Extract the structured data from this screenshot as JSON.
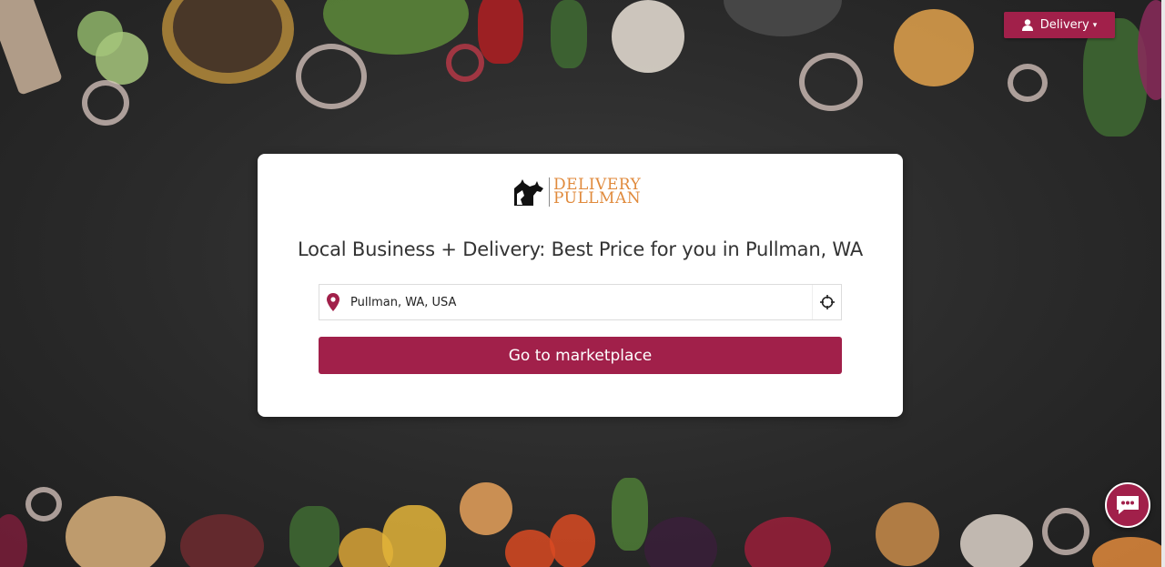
{
  "header": {
    "delivery_label": "Delivery"
  },
  "logo": {
    "line1": "DELIVERY",
    "line2": "PULLMAN"
  },
  "main": {
    "headline": "Local Business + Delivery: Best Price for you in Pullman, WA",
    "location_value": "Pullman, WA, USA",
    "go_label": "Go to marketplace"
  },
  "colors": {
    "brand": "#a1204a",
    "logo_text": "#e08a3c"
  },
  "icons": [
    "user-icon",
    "caret-down-icon",
    "map-pin-icon",
    "crosshair-icon",
    "chat-icon"
  ]
}
